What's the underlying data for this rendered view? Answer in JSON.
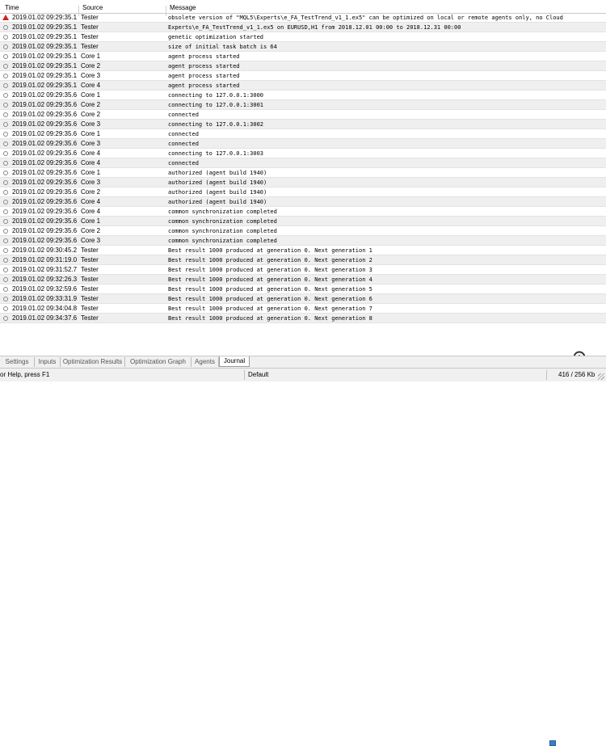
{
  "columns": {
    "time": "Time",
    "source": "Source",
    "message": "Message"
  },
  "rows": [
    {
      "icon": "warn",
      "time": "2019.01.02 09:29:35.1...",
      "source": "Tester",
      "message": "obsolete version of \"MQL5\\Experts\\e_FA_TestTrend_v1_1.ex5\" can be optimized on local or remote agents only, no Cloud"
    },
    {
      "icon": "info",
      "time": "2019.01.02 09:29:35.1...",
      "source": "Tester",
      "message": "Experts\\e_FA_TestTrend_v1_1.ex5 on EURUSD,H1 from 2018.12.01 00:00 to 2018.12.31 00:00"
    },
    {
      "icon": "info",
      "time": "2019.01.02 09:29:35.1...",
      "source": "Tester",
      "message": "genetic optimization started"
    },
    {
      "icon": "info",
      "time": "2019.01.02 09:29:35.1...",
      "source": "Tester",
      "message": "size of initial task batch is 64"
    },
    {
      "icon": "info",
      "time": "2019.01.02 09:29:35.1...",
      "source": "Core 1",
      "message": "agent process started"
    },
    {
      "icon": "info",
      "time": "2019.01.02 09:29:35.1...",
      "source": "Core 2",
      "message": "agent process started"
    },
    {
      "icon": "info",
      "time": "2019.01.02 09:29:35.1...",
      "source": "Core 3",
      "message": "agent process started"
    },
    {
      "icon": "info",
      "time": "2019.01.02 09:29:35.1...",
      "source": "Core 4",
      "message": "agent process started"
    },
    {
      "icon": "info",
      "time": "2019.01.02 09:29:35.6...",
      "source": "Core 1",
      "message": "connecting to 127.0.0.1:3000"
    },
    {
      "icon": "info",
      "time": "2019.01.02 09:29:35.6...",
      "source": "Core 2",
      "message": "connecting to 127.0.0.1:3001"
    },
    {
      "icon": "info",
      "time": "2019.01.02 09:29:35.6...",
      "source": "Core 2",
      "message": "connected"
    },
    {
      "icon": "info",
      "time": "2019.01.02 09:29:35.6...",
      "source": "Core 3",
      "message": "connecting to 127.0.0.1:3002"
    },
    {
      "icon": "info",
      "time": "2019.01.02 09:29:35.6...",
      "source": "Core 1",
      "message": "connected"
    },
    {
      "icon": "info",
      "time": "2019.01.02 09:29:35.6...",
      "source": "Core 3",
      "message": "connected"
    },
    {
      "icon": "info",
      "time": "2019.01.02 09:29:35.6...",
      "source": "Core 4",
      "message": "connecting to 127.0.0.1:3003"
    },
    {
      "icon": "info",
      "time": "2019.01.02 09:29:35.6...",
      "source": "Core 4",
      "message": "connected"
    },
    {
      "icon": "info",
      "time": "2019.01.02 09:29:35.6...",
      "source": "Core 1",
      "message": "authorized (agent build 1940)"
    },
    {
      "icon": "info",
      "time": "2019.01.02 09:29:35.6...",
      "source": "Core 3",
      "message": "authorized (agent build 1940)"
    },
    {
      "icon": "info",
      "time": "2019.01.02 09:29:35.6...",
      "source": "Core 2",
      "message": "authorized (agent build 1940)"
    },
    {
      "icon": "info",
      "time": "2019.01.02 09:29:35.6...",
      "source": "Core 4",
      "message": "authorized (agent build 1940)"
    },
    {
      "icon": "info",
      "time": "2019.01.02 09:29:35.6...",
      "source": "Core 4",
      "message": "common synchronization completed"
    },
    {
      "icon": "info",
      "time": "2019.01.02 09:29:35.6...",
      "source": "Core 1",
      "message": "common synchronization completed"
    },
    {
      "icon": "info",
      "time": "2019.01.02 09:29:35.6...",
      "source": "Core 2",
      "message": "common synchronization completed"
    },
    {
      "icon": "info",
      "time": "2019.01.02 09:29:35.6...",
      "source": "Core 3",
      "message": "common synchronization completed"
    },
    {
      "icon": "info",
      "time": "2019.01.02 09:30:45.2...",
      "source": "Tester",
      "message": "Best result 1000 produced at generation 0. Next generation 1"
    },
    {
      "icon": "info",
      "time": "2019.01.02 09:31:19.0...",
      "source": "Tester",
      "message": "Best result 1000 produced at generation 0. Next generation 2"
    },
    {
      "icon": "info",
      "time": "2019.01.02 09:31:52.7...",
      "source": "Tester",
      "message": "Best result 1000 produced at generation 0. Next generation 3"
    },
    {
      "icon": "info",
      "time": "2019.01.02 09:32:26.3...",
      "source": "Tester",
      "message": "Best result 1000 produced at generation 0. Next generation 4"
    },
    {
      "icon": "info",
      "time": "2019.01.02 09:32:59.6...",
      "source": "Tester",
      "message": "Best result 1000 produced at generation 0. Next generation 5"
    },
    {
      "icon": "info",
      "time": "2019.01.02 09:33:31.9...",
      "source": "Tester",
      "message": "Best result 1000 produced at generation 0. Next generation 6"
    },
    {
      "icon": "info",
      "time": "2019.01.02 09:34:04.8...",
      "source": "Tester",
      "message": "Best result 1000 produced at generation 0. Next generation 7"
    },
    {
      "icon": "info",
      "time": "2019.01.02 09:34:37.6...",
      "source": "Tester",
      "message": "Best result 1000 produced at generation 0. Next generation 8"
    }
  ],
  "tabs": [
    {
      "label": "Settings",
      "active": false
    },
    {
      "label": "Inputs",
      "active": false
    },
    {
      "label": "Optimization Results",
      "active": false
    },
    {
      "label": "Optimization Graph",
      "active": false
    },
    {
      "label": "Agents",
      "active": false
    },
    {
      "label": "Journal",
      "active": true
    }
  ],
  "status": {
    "help": "or Help, press F1",
    "profile": "Default",
    "traffic": "416 / 256 Kb"
  },
  "icons": {
    "warning": "warning-triangle-icon",
    "info": "info-circle-icon",
    "zoom": "zoom-magnifier-icon",
    "network": "network-icon"
  },
  "colors": {
    "warning": "#d32020",
    "alt_row": "#efefef",
    "network": "#3a7fc4"
  }
}
